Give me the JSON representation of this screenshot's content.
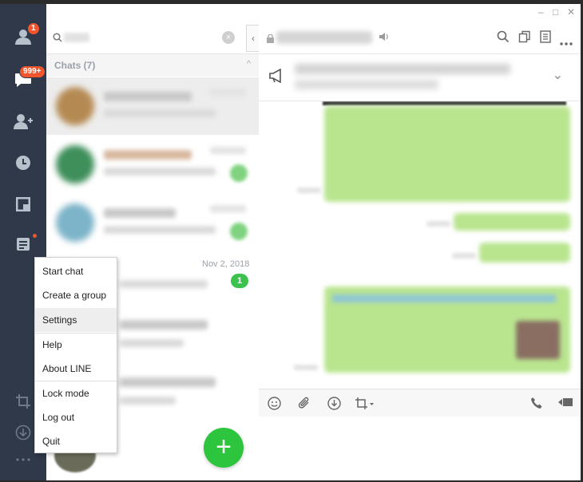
{
  "rail": {
    "friends_badge": "1",
    "chats_badge": "999+"
  },
  "search": {
    "clear_label": "×",
    "collapse_label": "‹"
  },
  "chat_list": {
    "section_label": "Chats (7)",
    "section_caret": "^",
    "visible_date": "Nov 2, 2018",
    "visible_unread": "1",
    "add_label": "+"
  },
  "chat_header": {
    "minimize_label": "–",
    "maximize_label": "□",
    "close_label": "✕",
    "announcement_expand": "⌄"
  },
  "menu": {
    "items": [
      "Start chat",
      "Create a group",
      "Settings",
      "Help",
      "About LINE",
      "Lock mode",
      "Log out",
      "Quit"
    ],
    "highlighted": "Settings"
  },
  "colors": {
    "rail_bg": "#2f3949",
    "badge": "#f2552c",
    "accent_green": "#2ec53e",
    "bubble_green": "#b9e58f"
  },
  "icons": {
    "rail": [
      "friends-icon",
      "chats-icon",
      "add-friend-icon",
      "timeline-icon",
      "keep-icon",
      "notes-icon",
      "screenshot-icon",
      "download-icon",
      "more-icon"
    ],
    "chat_header": [
      "search-icon",
      "copy-icon",
      "notes-icon",
      "more-icon"
    ],
    "toolbar": [
      "emoji-icon",
      "attach-icon",
      "keep-save-icon",
      "crop-icon",
      "call-icon",
      "video-call-icon"
    ]
  }
}
